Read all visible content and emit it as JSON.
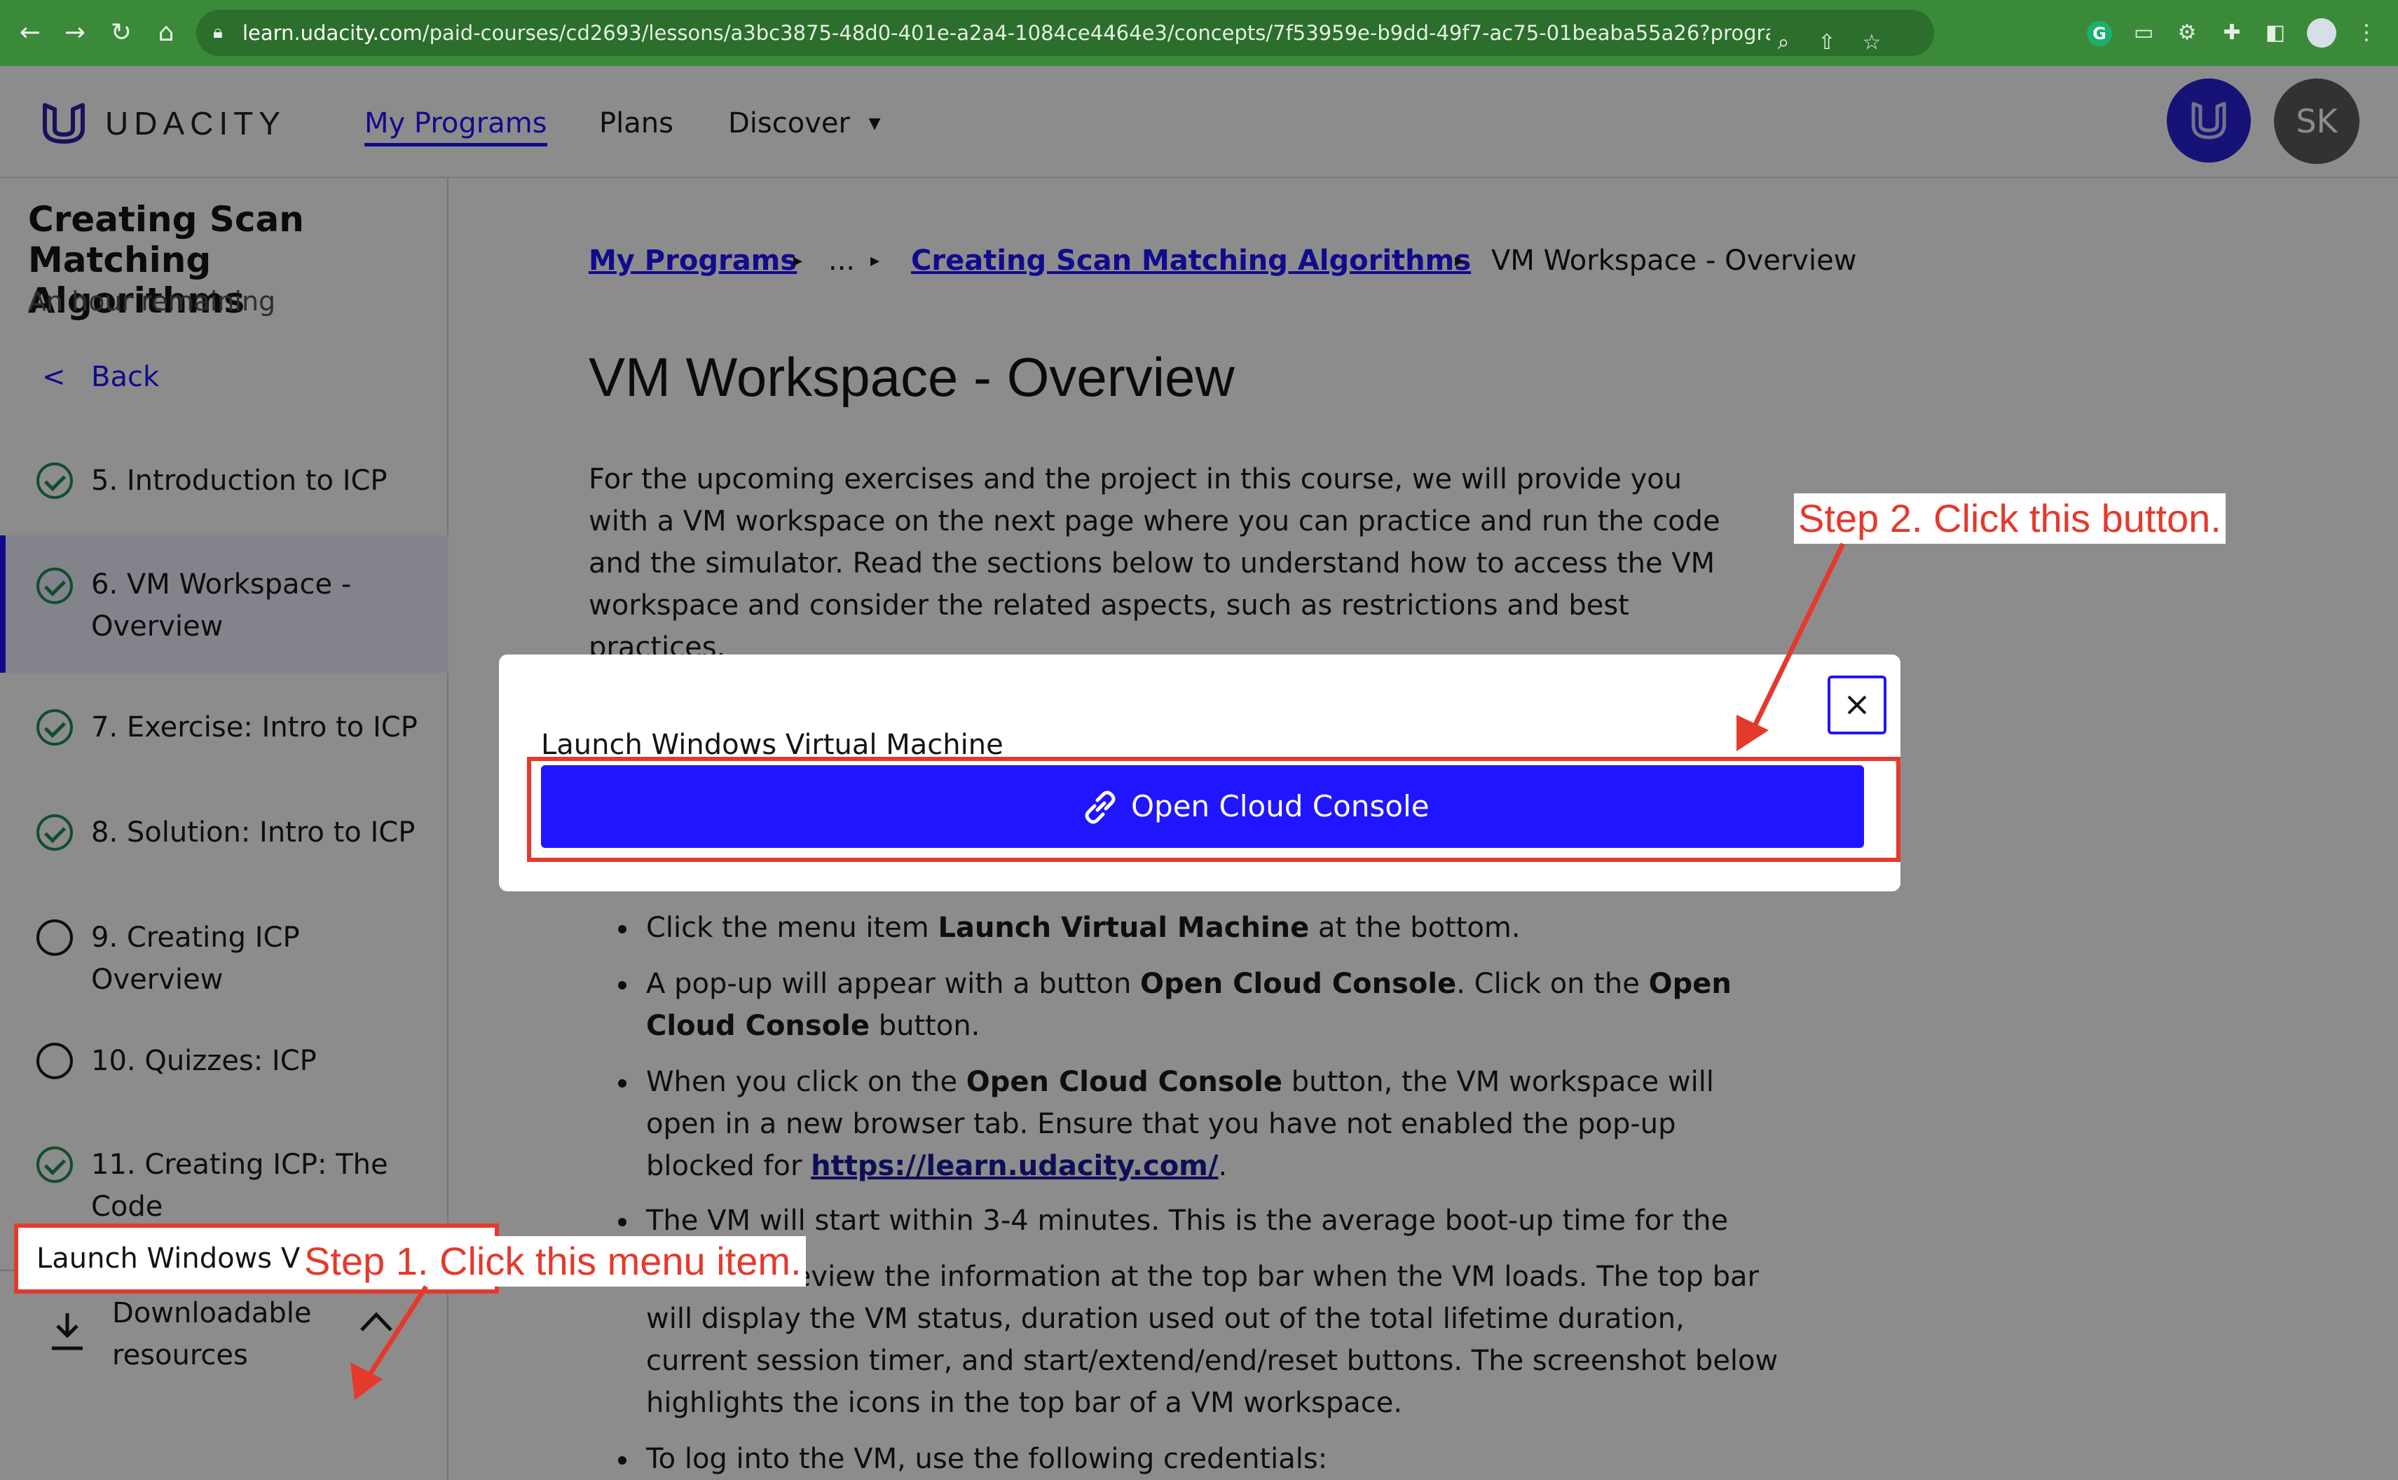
{
  "browser": {
    "url_host": "learn.udacity.com",
    "url_path": "/paid-courses/cd2693/lessons/a3bc3875-48d0-401e-a2a4-1084ce4464e3/concepts/7f53959e-b9dd-49f7-ac75-01beaba55a26?program_version=2.0&progra...",
    "profile_color": "#d7dfe6"
  },
  "topnav": {
    "brand": "UDACITY",
    "links": [
      "My Programs",
      "Plans",
      "Discover"
    ],
    "discover_caret": "▼",
    "user_initials": "SK",
    "accent": "#2015ff"
  },
  "sidebar": {
    "course_title": "Creating Scan Matching Algorithms",
    "remaining": "An hour remaining",
    "back_label": "Back",
    "lessons": [
      {
        "label": "5. Introduction to ICP",
        "status": "done"
      },
      {
        "label": "6. VM Workspace - Overview",
        "status": "done",
        "active": true
      },
      {
        "label": "7. Exercise: Intro to ICP",
        "status": "done"
      },
      {
        "label": "8. Solution: Intro to ICP",
        "status": "done"
      },
      {
        "label": "9. Creating ICP Overview",
        "status": "todo"
      },
      {
        "label": "10. Quizzes: ICP",
        "status": "todo"
      },
      {
        "label": "11. Creating ICP: The Code",
        "status": "done"
      }
    ],
    "downloadable": "Downloadable resources",
    "launch_vm": "Launch Windows Virtual Machine"
  },
  "main": {
    "breadcrumb": {
      "root": "My Programs",
      "ellipsis": "...",
      "course": "Creating Scan Matching Algorithms",
      "current": "VM Workspace - Overview",
      "sep": "▸"
    },
    "title": "VM Workspace - Overview",
    "intro": "For the upcoming exercises and the project in this course, we will provide you with a VM workspace on the next page where you can practice and run the code and the simulator. Read the sections below to understand how to access the VM workspace and consider the related aspects, such as restrictions and best practices.",
    "bullets": {
      "b1_pre": "Click the menu item ",
      "b1_bold": "Launch Virtual Machine",
      "b1_post": " at the bottom.",
      "b2_pre": "A pop-up will appear with a button ",
      "b2_bold1": "Open Cloud Console",
      "b2_mid": ". Click on the ",
      "b2_bold2": "Open Cloud Console",
      "b2_post": " button.",
      "b3_pre": "When you click on the ",
      "b3_bold": "Open Cloud Console",
      "b3_mid": " button, the VM workspace will open in a new browser tab. Ensure that you have not enabled the pop-up blocked for ",
      "b3_link": "https://learn.udacity.com/",
      "b3_post": ".",
      "b4": "The VM will start within 3-4 minutes. This is the average boot-up time for the machine.",
      "b5": "You must review the information at the top bar when the VM loads. The top bar will display the VM status, duration used out of the total lifetime duration, current session timer, and start/extend/end/reset buttons. The screenshot below highlights the icons in the top bar of a VM workspace.",
      "b6": "To log into the VM, use the following credentials:"
    }
  },
  "modal": {
    "title": "Launch Windows Virtual Machine",
    "button_label": "Open Cloud Console",
    "close_icon": "close-icon"
  },
  "annotations": {
    "step1": "Step 1. Click this menu item.",
    "step2": "Step 2. Click this button.",
    "color": "#e5392c"
  }
}
